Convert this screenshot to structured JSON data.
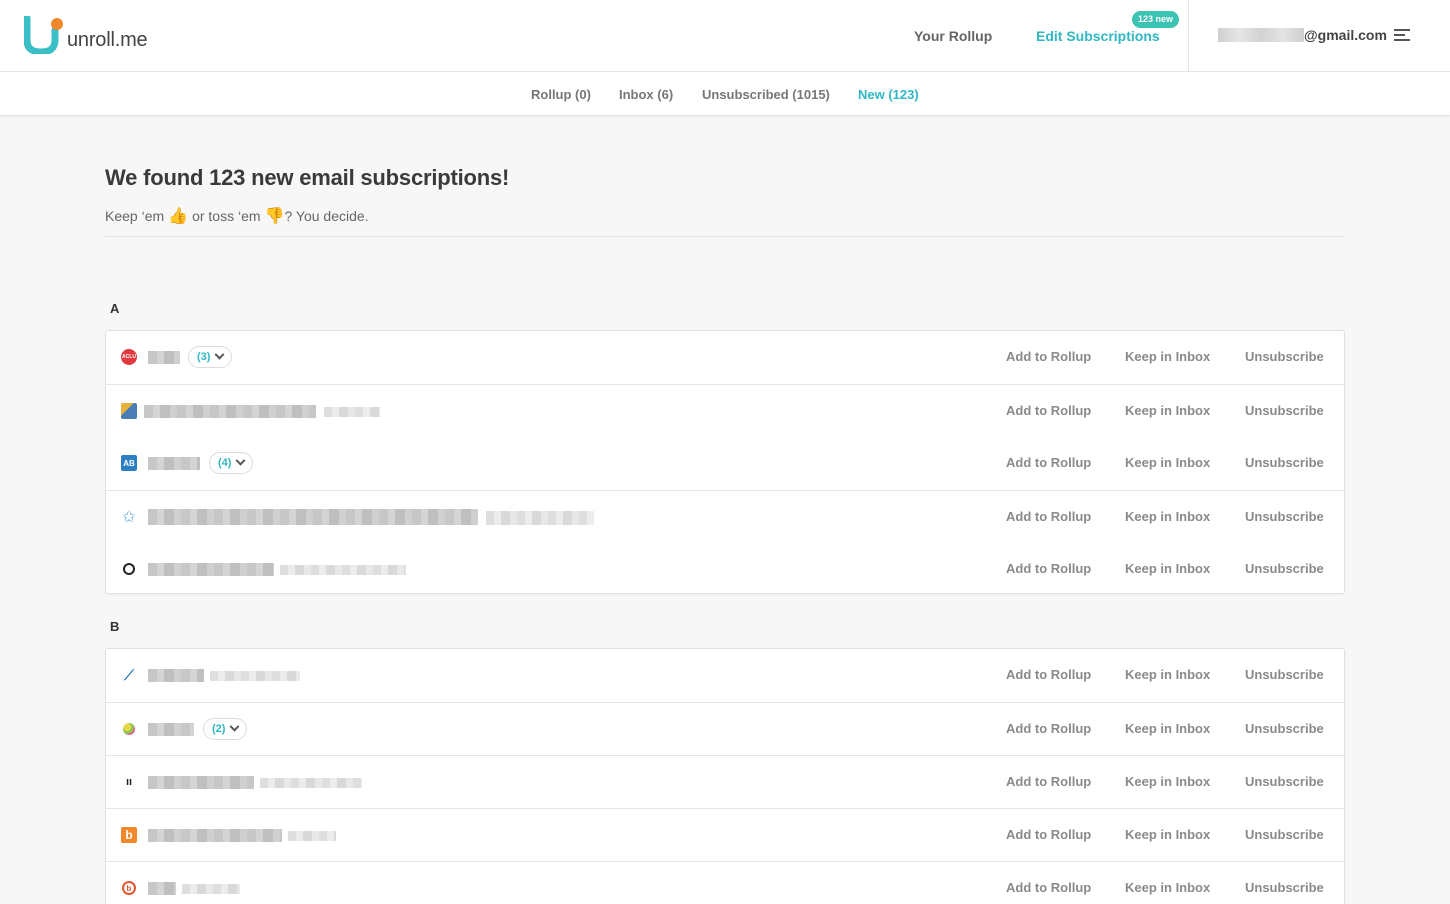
{
  "header": {
    "logo_text": "unroll.me",
    "nav": {
      "your_rollup": "Your Rollup",
      "edit_subscriptions": "Edit Subscriptions"
    },
    "new_badge": "123 new",
    "account_suffix": "@gmail.com",
    "account_name_redacted": true
  },
  "subnav": {
    "tabs": [
      {
        "label": "Rollup (0)",
        "active": false
      },
      {
        "label": "Inbox (6)",
        "active": false
      },
      {
        "label": "Unsubscribed (1015)",
        "active": false
      },
      {
        "label": "New (123)",
        "active": true
      }
    ]
  },
  "main": {
    "title": "We found 123 new email subscriptions!",
    "subtitle_part1": "Keep ‘em",
    "subtitle_part2": "or toss ‘em",
    "subtitle_part3": "? You decide.",
    "emoji_up": "👍",
    "emoji_down": "👎"
  },
  "actions": {
    "add": "Add to Rollup",
    "keep": "Keep in Inbox",
    "unsub": "Unsubscribe"
  },
  "groups": [
    {
      "letter": "A",
      "rows": [
        {
          "icon": "aclu-icon",
          "count": "(3)"
        },
        {
          "icon": "globe-icon",
          "count": null
        },
        {
          "icon": "ab-icon",
          "icon_text": "AB",
          "count": "(4)"
        },
        {
          "icon": "star-icon",
          "count": null
        },
        {
          "icon": "ring-icon",
          "count": null
        }
      ]
    },
    {
      "letter": "B",
      "rows": [
        {
          "icon": "swoosh-icon",
          "count": null
        },
        {
          "icon": "bubble-icon",
          "count": "(2)"
        },
        {
          "icon": "bars-icon",
          "count": null
        },
        {
          "icon": "b-square-icon",
          "icon_text": "b",
          "count": null
        },
        {
          "icon": "b-circle-icon",
          "count": null
        }
      ]
    }
  ],
  "colors": {
    "accent": "#2fb7c4",
    "badge": "#3cc3b3",
    "aclu_red": "#e03a3e",
    "ab_blue": "#2b7fc2",
    "orange": "#f0872a"
  }
}
